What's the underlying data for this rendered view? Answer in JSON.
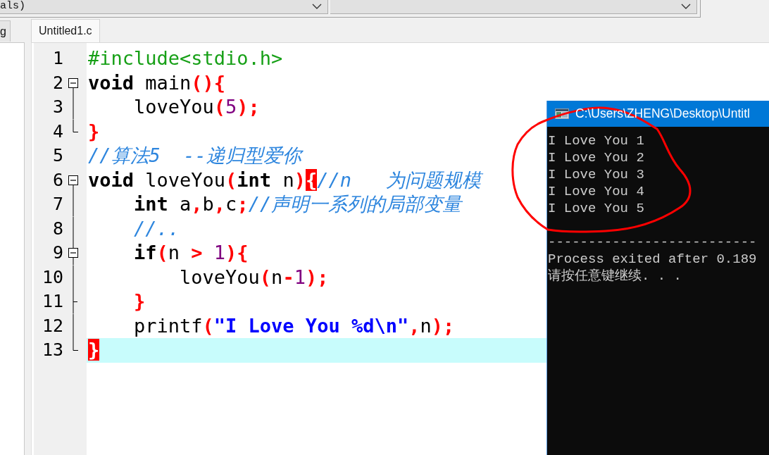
{
  "toolbar": {
    "dropdown": {
      "value": "als)"
    }
  },
  "left_panel": {
    "tabs": [
      {
        "label": "g",
        "selected": false
      }
    ]
  },
  "editor": {
    "tabs": [
      {
        "label": "Untitled1.c",
        "selected": true
      }
    ],
    "lines": [
      {
        "number": "1",
        "current": false,
        "tokens": [
          {
            "kind": "pre",
            "text": "#include<stdio.h>"
          }
        ]
      },
      {
        "number": "2",
        "current": false,
        "fold": {
          "kind": "toggle",
          "expanded": true
        },
        "tokens": [
          {
            "kind": "kw",
            "text": "void"
          },
          {
            "kind": "id",
            "text": " main"
          },
          {
            "kind": "sym",
            "text": "(){"
          }
        ]
      },
      {
        "number": "3",
        "current": false,
        "fold": {
          "kind": "line"
        },
        "tokens": [
          {
            "kind": "id",
            "text": "    loveYou"
          },
          {
            "kind": "sym",
            "text": "("
          },
          {
            "kind": "num",
            "text": "5"
          },
          {
            "kind": "sym",
            "text": ");"
          }
        ]
      },
      {
        "number": "4",
        "current": false,
        "fold": {
          "kind": "end"
        },
        "tokens": [
          {
            "kind": "sym",
            "text": "}"
          }
        ]
      },
      {
        "number": "5",
        "current": false,
        "tokens": [
          {
            "kind": "com",
            "text": "//算法5  --递归型爱你"
          }
        ]
      },
      {
        "number": "6",
        "current": false,
        "fold": {
          "kind": "toggle",
          "expanded": true
        },
        "tokens": [
          {
            "kind": "kw",
            "text": "void"
          },
          {
            "kind": "id",
            "text": " loveYou"
          },
          {
            "kind": "sym",
            "text": "("
          },
          {
            "kind": "kw",
            "text": "int"
          },
          {
            "kind": "id",
            "text": " n"
          },
          {
            "kind": "sym",
            "text": ")"
          },
          {
            "kind": "match",
            "text": "{"
          },
          {
            "kind": "com",
            "text": "//n   为问题规模"
          }
        ]
      },
      {
        "number": "7",
        "current": false,
        "fold": {
          "kind": "line"
        },
        "tokens": [
          {
            "kind": "kw",
            "text": "    int"
          },
          {
            "kind": "id",
            "text": " a"
          },
          {
            "kind": "sym",
            "text": ","
          },
          {
            "kind": "id",
            "text": "b"
          },
          {
            "kind": "sym",
            "text": ","
          },
          {
            "kind": "id",
            "text": "c"
          },
          {
            "kind": "sym",
            "text": ";"
          },
          {
            "kind": "com",
            "text": "//声明一系列的局部变量"
          }
        ]
      },
      {
        "number": "8",
        "current": false,
        "fold": {
          "kind": "line"
        },
        "tokens": [
          {
            "kind": "com",
            "text": "    //.."
          }
        ]
      },
      {
        "number": "9",
        "current": false,
        "fold": {
          "kind": "nested_toggle",
          "expanded": true
        },
        "tokens": [
          {
            "kind": "kw",
            "text": "    if"
          },
          {
            "kind": "sym",
            "text": "("
          },
          {
            "kind": "id",
            "text": "n "
          },
          {
            "kind": "sym",
            "text": ">"
          },
          {
            "kind": "num",
            "text": " 1"
          },
          {
            "kind": "sym",
            "text": "){"
          }
        ]
      },
      {
        "number": "10",
        "current": false,
        "fold": {
          "kind": "line"
        },
        "tokens": [
          {
            "kind": "id",
            "text": "        loveYou"
          },
          {
            "kind": "sym",
            "text": "("
          },
          {
            "kind": "id",
            "text": "n"
          },
          {
            "kind": "sym",
            "text": "-"
          },
          {
            "kind": "num",
            "text": "1"
          },
          {
            "kind": "sym",
            "text": ");"
          }
        ]
      },
      {
        "number": "11",
        "current": false,
        "fold": {
          "kind": "branch_end"
        },
        "tokens": [
          {
            "kind": "sym",
            "text": "    }"
          }
        ]
      },
      {
        "number": "12",
        "current": false,
        "fold": {
          "kind": "line"
        },
        "tokens": [
          {
            "kind": "id",
            "text": "    printf"
          },
          {
            "kind": "sym",
            "text": "("
          },
          {
            "kind": "str",
            "text": "\"I Love You %d\\n\""
          },
          {
            "kind": "sym",
            "text": ","
          },
          {
            "kind": "id",
            "text": "n"
          },
          {
            "kind": "sym",
            "text": ");"
          }
        ]
      },
      {
        "number": "13",
        "current": true,
        "fold": {
          "kind": "end"
        },
        "tokens": [
          {
            "kind": "match",
            "text": "}"
          }
        ]
      }
    ]
  },
  "console": {
    "title": "C:\\Users\\ZHENG\\Desktop\\Untitl",
    "output": [
      "I Love You 1",
      "I Love You 2",
      "I Love You 3",
      "I Love You 4",
      "I Love You 5"
    ],
    "separator": "--------------------------",
    "footer": [
      "Process exited after 0.189",
      "请按任意键继续. . ."
    ]
  },
  "annotation": {
    "kind": "circle"
  }
}
